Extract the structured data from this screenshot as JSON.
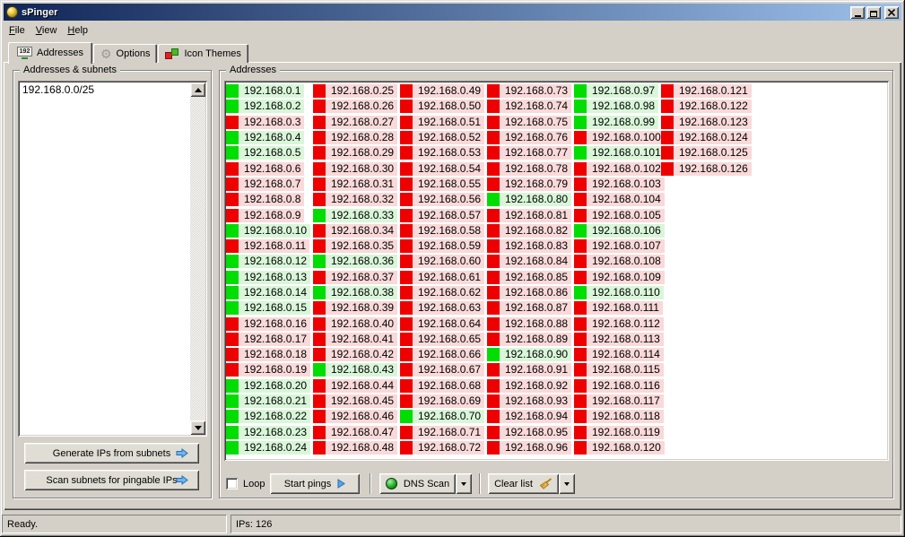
{
  "window": {
    "title": "sPinger"
  },
  "menu": {
    "items": [
      {
        "label": "File"
      },
      {
        "label": "View"
      },
      {
        "label": "Help"
      }
    ]
  },
  "tabs": [
    {
      "label": "Addresses",
      "icon": "monitor-192-icon",
      "active": true,
      "screen_text": "192"
    },
    {
      "label": "Options",
      "icon": "gear-icon",
      "active": false,
      "gear_glyph": "⚙"
    },
    {
      "label": "Icon Themes",
      "icon": "blocks-icon",
      "active": false
    }
  ],
  "subnets_panel": {
    "title": "Addresses & subnets",
    "textarea_value": "192.168.0.0/25",
    "generate_button_label": "Generate IPs from subnets",
    "scan_button_label": "Scan subnets for pingable IPs"
  },
  "addresses_panel": {
    "title": "Addresses",
    "rows_per_column": 24,
    "items": [
      {
        "ip": "192.168.0.1",
        "up": true
      },
      {
        "ip": "192.168.0.2",
        "up": true
      },
      {
        "ip": "192.168.0.3",
        "up": false
      },
      {
        "ip": "192.168.0.4",
        "up": true
      },
      {
        "ip": "192.168.0.5",
        "up": true
      },
      {
        "ip": "192.168.0.6",
        "up": false
      },
      {
        "ip": "192.168.0.7",
        "up": false
      },
      {
        "ip": "192.168.0.8",
        "up": false
      },
      {
        "ip": "192.168.0.9",
        "up": false
      },
      {
        "ip": "192.168.0.10",
        "up": true
      },
      {
        "ip": "192.168.0.11",
        "up": false
      },
      {
        "ip": "192.168.0.12",
        "up": true
      },
      {
        "ip": "192.168.0.13",
        "up": true
      },
      {
        "ip": "192.168.0.14",
        "up": true
      },
      {
        "ip": "192.168.0.15",
        "up": true
      },
      {
        "ip": "192.168.0.16",
        "up": false
      },
      {
        "ip": "192.168.0.17",
        "up": false
      },
      {
        "ip": "192.168.0.18",
        "up": false
      },
      {
        "ip": "192.168.0.19",
        "up": false
      },
      {
        "ip": "192.168.0.20",
        "up": true
      },
      {
        "ip": "192.168.0.21",
        "up": true
      },
      {
        "ip": "192.168.0.22",
        "up": true
      },
      {
        "ip": "192.168.0.23",
        "up": true
      },
      {
        "ip": "192.168.0.24",
        "up": true
      },
      {
        "ip": "192.168.0.25",
        "up": false
      },
      {
        "ip": "192.168.0.26",
        "up": false
      },
      {
        "ip": "192.168.0.27",
        "up": false
      },
      {
        "ip": "192.168.0.28",
        "up": false
      },
      {
        "ip": "192.168.0.29",
        "up": false
      },
      {
        "ip": "192.168.0.30",
        "up": false
      },
      {
        "ip": "192.168.0.31",
        "up": false
      },
      {
        "ip": "192.168.0.32",
        "up": false
      },
      {
        "ip": "192.168.0.33",
        "up": true
      },
      {
        "ip": "192.168.0.34",
        "up": false
      },
      {
        "ip": "192.168.0.35",
        "up": false
      },
      {
        "ip": "192.168.0.36",
        "up": true
      },
      {
        "ip": "192.168.0.37",
        "up": false
      },
      {
        "ip": "192.168.0.38",
        "up": true
      },
      {
        "ip": "192.168.0.39",
        "up": false
      },
      {
        "ip": "192.168.0.40",
        "up": false
      },
      {
        "ip": "192.168.0.41",
        "up": false
      },
      {
        "ip": "192.168.0.42",
        "up": false
      },
      {
        "ip": "192.168.0.43",
        "up": true
      },
      {
        "ip": "192.168.0.44",
        "up": false
      },
      {
        "ip": "192.168.0.45",
        "up": false
      },
      {
        "ip": "192.168.0.46",
        "up": false
      },
      {
        "ip": "192.168.0.47",
        "up": false
      },
      {
        "ip": "192.168.0.48",
        "up": false
      },
      {
        "ip": "192.168.0.49",
        "up": false
      },
      {
        "ip": "192.168.0.50",
        "up": false
      },
      {
        "ip": "192.168.0.51",
        "up": false
      },
      {
        "ip": "192.168.0.52",
        "up": false
      },
      {
        "ip": "192.168.0.53",
        "up": false
      },
      {
        "ip": "192.168.0.54",
        "up": false
      },
      {
        "ip": "192.168.0.55",
        "up": false
      },
      {
        "ip": "192.168.0.56",
        "up": false
      },
      {
        "ip": "192.168.0.57",
        "up": false
      },
      {
        "ip": "192.168.0.58",
        "up": false
      },
      {
        "ip": "192.168.0.59",
        "up": false
      },
      {
        "ip": "192.168.0.60",
        "up": false
      },
      {
        "ip": "192.168.0.61",
        "up": false
      },
      {
        "ip": "192.168.0.62",
        "up": false
      },
      {
        "ip": "192.168.0.63",
        "up": false
      },
      {
        "ip": "192.168.0.64",
        "up": false
      },
      {
        "ip": "192.168.0.65",
        "up": false
      },
      {
        "ip": "192.168.0.66",
        "up": false
      },
      {
        "ip": "192.168.0.67",
        "up": false
      },
      {
        "ip": "192.168.0.68",
        "up": false
      },
      {
        "ip": "192.168.0.69",
        "up": false
      },
      {
        "ip": "192.168.0.70",
        "up": true
      },
      {
        "ip": "192.168.0.71",
        "up": false
      },
      {
        "ip": "192.168.0.72",
        "up": false
      },
      {
        "ip": "192.168.0.73",
        "up": false
      },
      {
        "ip": "192.168.0.74",
        "up": false
      },
      {
        "ip": "192.168.0.75",
        "up": false
      },
      {
        "ip": "192.168.0.76",
        "up": false
      },
      {
        "ip": "192.168.0.77",
        "up": false
      },
      {
        "ip": "192.168.0.78",
        "up": false
      },
      {
        "ip": "192.168.0.79",
        "up": false
      },
      {
        "ip": "192.168.0.80",
        "up": true
      },
      {
        "ip": "192.168.0.81",
        "up": false
      },
      {
        "ip": "192.168.0.82",
        "up": false
      },
      {
        "ip": "192.168.0.83",
        "up": false
      },
      {
        "ip": "192.168.0.84",
        "up": false
      },
      {
        "ip": "192.168.0.85",
        "up": false
      },
      {
        "ip": "192.168.0.86",
        "up": false
      },
      {
        "ip": "192.168.0.87",
        "up": false
      },
      {
        "ip": "192.168.0.88",
        "up": false
      },
      {
        "ip": "192.168.0.89",
        "up": false
      },
      {
        "ip": "192.168.0.90",
        "up": true
      },
      {
        "ip": "192.168.0.91",
        "up": false
      },
      {
        "ip": "192.168.0.92",
        "up": false
      },
      {
        "ip": "192.168.0.93",
        "up": false
      },
      {
        "ip": "192.168.0.94",
        "up": false
      },
      {
        "ip": "192.168.0.95",
        "up": false
      },
      {
        "ip": "192.168.0.96",
        "up": false
      },
      {
        "ip": "192.168.0.97",
        "up": true
      },
      {
        "ip": "192.168.0.98",
        "up": true
      },
      {
        "ip": "192.168.0.99",
        "up": true
      },
      {
        "ip": "192.168.0.100",
        "up": false
      },
      {
        "ip": "192.168.0.101",
        "up": true
      },
      {
        "ip": "192.168.0.102",
        "up": false
      },
      {
        "ip": "192.168.0.103",
        "up": false
      },
      {
        "ip": "192.168.0.104",
        "up": false
      },
      {
        "ip": "192.168.0.105",
        "up": false
      },
      {
        "ip": "192.168.0.106",
        "up": true
      },
      {
        "ip": "192.168.0.107",
        "up": false
      },
      {
        "ip": "192.168.0.108",
        "up": false
      },
      {
        "ip": "192.168.0.109",
        "up": false
      },
      {
        "ip": "192.168.0.110",
        "up": true
      },
      {
        "ip": "192.168.0.111",
        "up": false
      },
      {
        "ip": "192.168.0.112",
        "up": false
      },
      {
        "ip": "192.168.0.113",
        "up": false
      },
      {
        "ip": "192.168.0.114",
        "up": false
      },
      {
        "ip": "192.168.0.115",
        "up": false
      },
      {
        "ip": "192.168.0.116",
        "up": false
      },
      {
        "ip": "192.168.0.117",
        "up": false
      },
      {
        "ip": "192.168.0.118",
        "up": false
      },
      {
        "ip": "192.168.0.119",
        "up": false
      },
      {
        "ip": "192.168.0.120",
        "up": false
      },
      {
        "ip": "192.168.0.121",
        "up": false
      },
      {
        "ip": "192.168.0.122",
        "up": false
      },
      {
        "ip": "192.168.0.123",
        "up": false
      },
      {
        "ip": "192.168.0.124",
        "up": false
      },
      {
        "ip": "192.168.0.125",
        "up": false
      },
      {
        "ip": "192.168.0.126",
        "up": false
      }
    ]
  },
  "toolbar": {
    "loop_checkbox": {
      "label": "Loop",
      "checked": false
    },
    "start_button": {
      "label": "Start pings",
      "icon": "play-icon"
    },
    "dns_button": {
      "label": "DNS Scan",
      "icon": "globe-icon",
      "has_dropdown": true
    },
    "clear_button": {
      "label": "Clear list",
      "icon": "broom-icon",
      "has_dropdown": true
    }
  },
  "status_bar": {
    "left": "Ready.",
    "right": "IPs: 126"
  },
  "colors": {
    "up_square": "#00dd00",
    "down_square": "#ee0000",
    "up_bg": "#d9f6d9",
    "down_bg": "#f9d9d9",
    "titlebar_left": "#0f2557",
    "titlebar_right": "#9dc1ea"
  }
}
